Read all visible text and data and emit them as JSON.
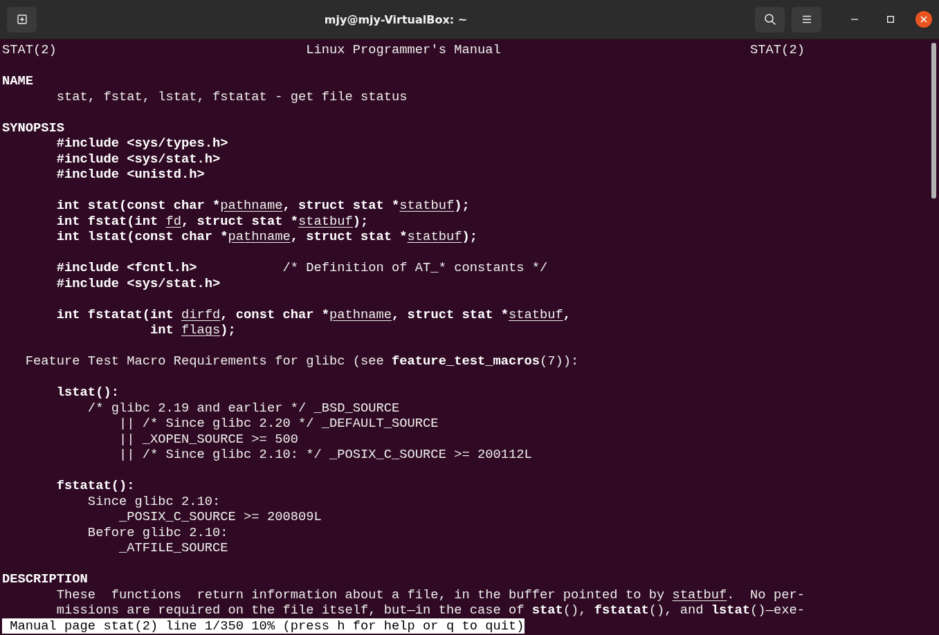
{
  "window": {
    "title": "mjy@mjy-VirtualBox: ~"
  },
  "terminal": {
    "lines": [
      {
        "kind": "text",
        "segments": [
          {
            "kind": "plain",
            "text": "STAT(2)                                Linux Programmer's Manual                                STAT(2)"
          }
        ]
      },
      {
        "kind": "blank"
      },
      {
        "kind": "text",
        "segments": [
          {
            "kind": "bold",
            "text": "NAME"
          }
        ]
      },
      {
        "kind": "text",
        "segments": [
          {
            "kind": "plain",
            "text": "       stat, fstat, lstat, fstatat - get file status"
          }
        ]
      },
      {
        "kind": "blank"
      },
      {
        "kind": "text",
        "segments": [
          {
            "kind": "bold",
            "text": "SYNOPSIS"
          }
        ]
      },
      {
        "kind": "text",
        "segments": [
          {
            "kind": "bold",
            "text": "       #include <sys/types.h>"
          }
        ]
      },
      {
        "kind": "text",
        "segments": [
          {
            "kind": "bold",
            "text": "       #include <sys/stat.h>"
          }
        ]
      },
      {
        "kind": "text",
        "segments": [
          {
            "kind": "bold",
            "text": "       #include <unistd.h>"
          }
        ]
      },
      {
        "kind": "blank"
      },
      {
        "kind": "text",
        "segments": [
          {
            "kind": "bold",
            "text": "       int stat(const char *"
          },
          {
            "kind": "underline",
            "text": "pathname"
          },
          {
            "kind": "bold",
            "text": ", struct stat *"
          },
          {
            "kind": "underline",
            "text": "statbuf"
          },
          {
            "kind": "bold",
            "text": ");"
          }
        ]
      },
      {
        "kind": "text",
        "segments": [
          {
            "kind": "bold",
            "text": "       int fstat(int "
          },
          {
            "kind": "underline",
            "text": "fd"
          },
          {
            "kind": "bold",
            "text": ", struct stat *"
          },
          {
            "kind": "underline",
            "text": "statbuf"
          },
          {
            "kind": "bold",
            "text": ");"
          }
        ]
      },
      {
        "kind": "text",
        "segments": [
          {
            "kind": "bold",
            "text": "       int lstat(const char *"
          },
          {
            "kind": "underline",
            "text": "pathname"
          },
          {
            "kind": "bold",
            "text": ", struct stat *"
          },
          {
            "kind": "underline",
            "text": "statbuf"
          },
          {
            "kind": "bold",
            "text": ");"
          }
        ]
      },
      {
        "kind": "blank"
      },
      {
        "kind": "text",
        "segments": [
          {
            "kind": "bold",
            "text": "       #include <fcntl.h>"
          },
          {
            "kind": "plain",
            "text": "           /* Definition of AT_* constants */"
          }
        ]
      },
      {
        "kind": "text",
        "segments": [
          {
            "kind": "bold",
            "text": "       #include <sys/stat.h>"
          }
        ]
      },
      {
        "kind": "blank"
      },
      {
        "kind": "text",
        "segments": [
          {
            "kind": "bold",
            "text": "       int fstatat(int "
          },
          {
            "kind": "underline",
            "text": "dirfd"
          },
          {
            "kind": "bold",
            "text": ", const char *"
          },
          {
            "kind": "underline",
            "text": "pathname"
          },
          {
            "kind": "bold",
            "text": ", struct stat *"
          },
          {
            "kind": "underline",
            "text": "statbuf"
          },
          {
            "kind": "bold",
            "text": ","
          }
        ]
      },
      {
        "kind": "text",
        "segments": [
          {
            "kind": "bold",
            "text": "                   int "
          },
          {
            "kind": "underline",
            "text": "flags"
          },
          {
            "kind": "bold",
            "text": ");"
          }
        ]
      },
      {
        "kind": "blank"
      },
      {
        "kind": "text",
        "segments": [
          {
            "kind": "plain",
            "text": "   Feature Test Macro Requirements for glibc (see "
          },
          {
            "kind": "bold",
            "text": "feature_test_macros"
          },
          {
            "kind": "plain",
            "text": "(7)):"
          }
        ]
      },
      {
        "kind": "blank"
      },
      {
        "kind": "text",
        "segments": [
          {
            "kind": "bold",
            "text": "       lstat():"
          }
        ]
      },
      {
        "kind": "text",
        "segments": [
          {
            "kind": "plain",
            "text": "           /* glibc 2.19 and earlier */ _BSD_SOURCE"
          }
        ]
      },
      {
        "kind": "text",
        "segments": [
          {
            "kind": "plain",
            "text": "               || /* Since glibc 2.20 */ _DEFAULT_SOURCE"
          }
        ]
      },
      {
        "kind": "text",
        "segments": [
          {
            "kind": "plain",
            "text": "               || _XOPEN_SOURCE >= 500"
          }
        ]
      },
      {
        "kind": "text",
        "segments": [
          {
            "kind": "plain",
            "text": "               || /* Since glibc 2.10: */ _POSIX_C_SOURCE >= 200112L"
          }
        ]
      },
      {
        "kind": "blank"
      },
      {
        "kind": "text",
        "segments": [
          {
            "kind": "bold",
            "text": "       fstatat():"
          }
        ]
      },
      {
        "kind": "text",
        "segments": [
          {
            "kind": "plain",
            "text": "           Since glibc 2.10:"
          }
        ]
      },
      {
        "kind": "text",
        "segments": [
          {
            "kind": "plain",
            "text": "               _POSIX_C_SOURCE >= 200809L"
          }
        ]
      },
      {
        "kind": "text",
        "segments": [
          {
            "kind": "plain",
            "text": "           Before glibc 2.10:"
          }
        ]
      },
      {
        "kind": "text",
        "segments": [
          {
            "kind": "plain",
            "text": "               _ATFILE_SOURCE"
          }
        ]
      },
      {
        "kind": "blank"
      },
      {
        "kind": "text",
        "segments": [
          {
            "kind": "bold",
            "text": "DESCRIPTION"
          }
        ]
      },
      {
        "kind": "text",
        "segments": [
          {
            "kind": "plain",
            "text": "       These  functions  return information about a file, in the buffer pointed to by "
          },
          {
            "kind": "underline",
            "text": "statbuf"
          },
          {
            "kind": "plain",
            "text": ".  No per‐"
          }
        ]
      },
      {
        "kind": "text",
        "segments": [
          {
            "kind": "plain",
            "text": "       missions are required on the file itself, but—in the case of "
          },
          {
            "kind": "bold",
            "text": "stat"
          },
          {
            "kind": "plain",
            "text": "(), "
          },
          {
            "kind": "bold",
            "text": "fstatat"
          },
          {
            "kind": "plain",
            "text": "(), and "
          },
          {
            "kind": "bold",
            "text": "lstat"
          },
          {
            "kind": "plain",
            "text": "()—exe‐"
          }
        ]
      },
      {
        "kind": "status",
        "segments": [
          {
            "kind": "plain",
            "text": " Manual page stat(2) line 1/350 10% (press h for help or q to quit)"
          }
        ]
      }
    ]
  }
}
